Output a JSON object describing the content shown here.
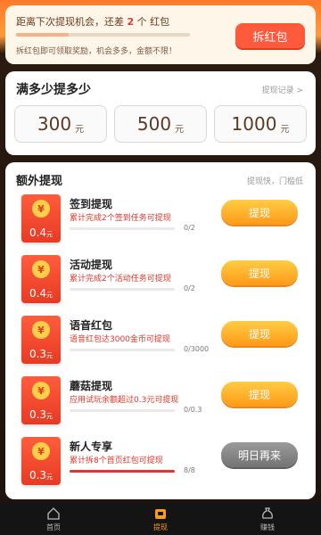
{
  "top_banner": {
    "prefix": "距离下次提现机会，还差",
    "count": "2",
    "suffix": "个 红包",
    "progress": 0.3,
    "tip": "拆红包即可领取奖励，机会多多，金额不限！",
    "button": "拆红包"
  },
  "withdraw": {
    "title": "满多少提多少",
    "record_link": "提现记录 >",
    "unit": "元",
    "amounts": [
      "300",
      "500",
      "1000"
    ]
  },
  "extra": {
    "title": "额外提现",
    "subtitle": "提现快，门槛低",
    "tasks": [
      {
        "name": "签到提现",
        "desc": "累计完成2个签到任务可提现",
        "amount": "0.4",
        "unit": "元",
        "progress": "0/2",
        "ratio": 0,
        "button": "提现",
        "enabled": true
      },
      {
        "name": "活动提现",
        "desc": "累计完成2个活动任务可提现",
        "amount": "0.4",
        "unit": "元",
        "progress": "0/2",
        "ratio": 0,
        "button": "提现",
        "enabled": true
      },
      {
        "name": "语音红包",
        "desc": "语音红包达3000金币可提现",
        "amount": "0.3",
        "unit": "元",
        "progress": "0/3000",
        "ratio": 0,
        "button": "提现",
        "enabled": true
      },
      {
        "name": "蘑菇提现",
        "desc": "应用试玩余额超过0.3元可提现",
        "amount": "0.3",
        "unit": "元",
        "progress": "0/0.3",
        "ratio": 0,
        "button": "提现",
        "enabled": true
      },
      {
        "name": "新人专享",
        "desc": "累计拆8个首页红包可提现",
        "amount": "0.3",
        "unit": "元",
        "progress": "8/8",
        "ratio": 1,
        "button": "明日再来",
        "enabled": false
      }
    ]
  },
  "nav": [
    {
      "label": "首页",
      "icon": "home-icon",
      "active": false
    },
    {
      "label": "提现",
      "icon": "wallet-icon",
      "active": true
    },
    {
      "label": "赚钱",
      "icon": "money-bag-icon",
      "active": false
    }
  ],
  "colors": {
    "accent": "#ff9a18",
    "red": "#e5352b"
  }
}
